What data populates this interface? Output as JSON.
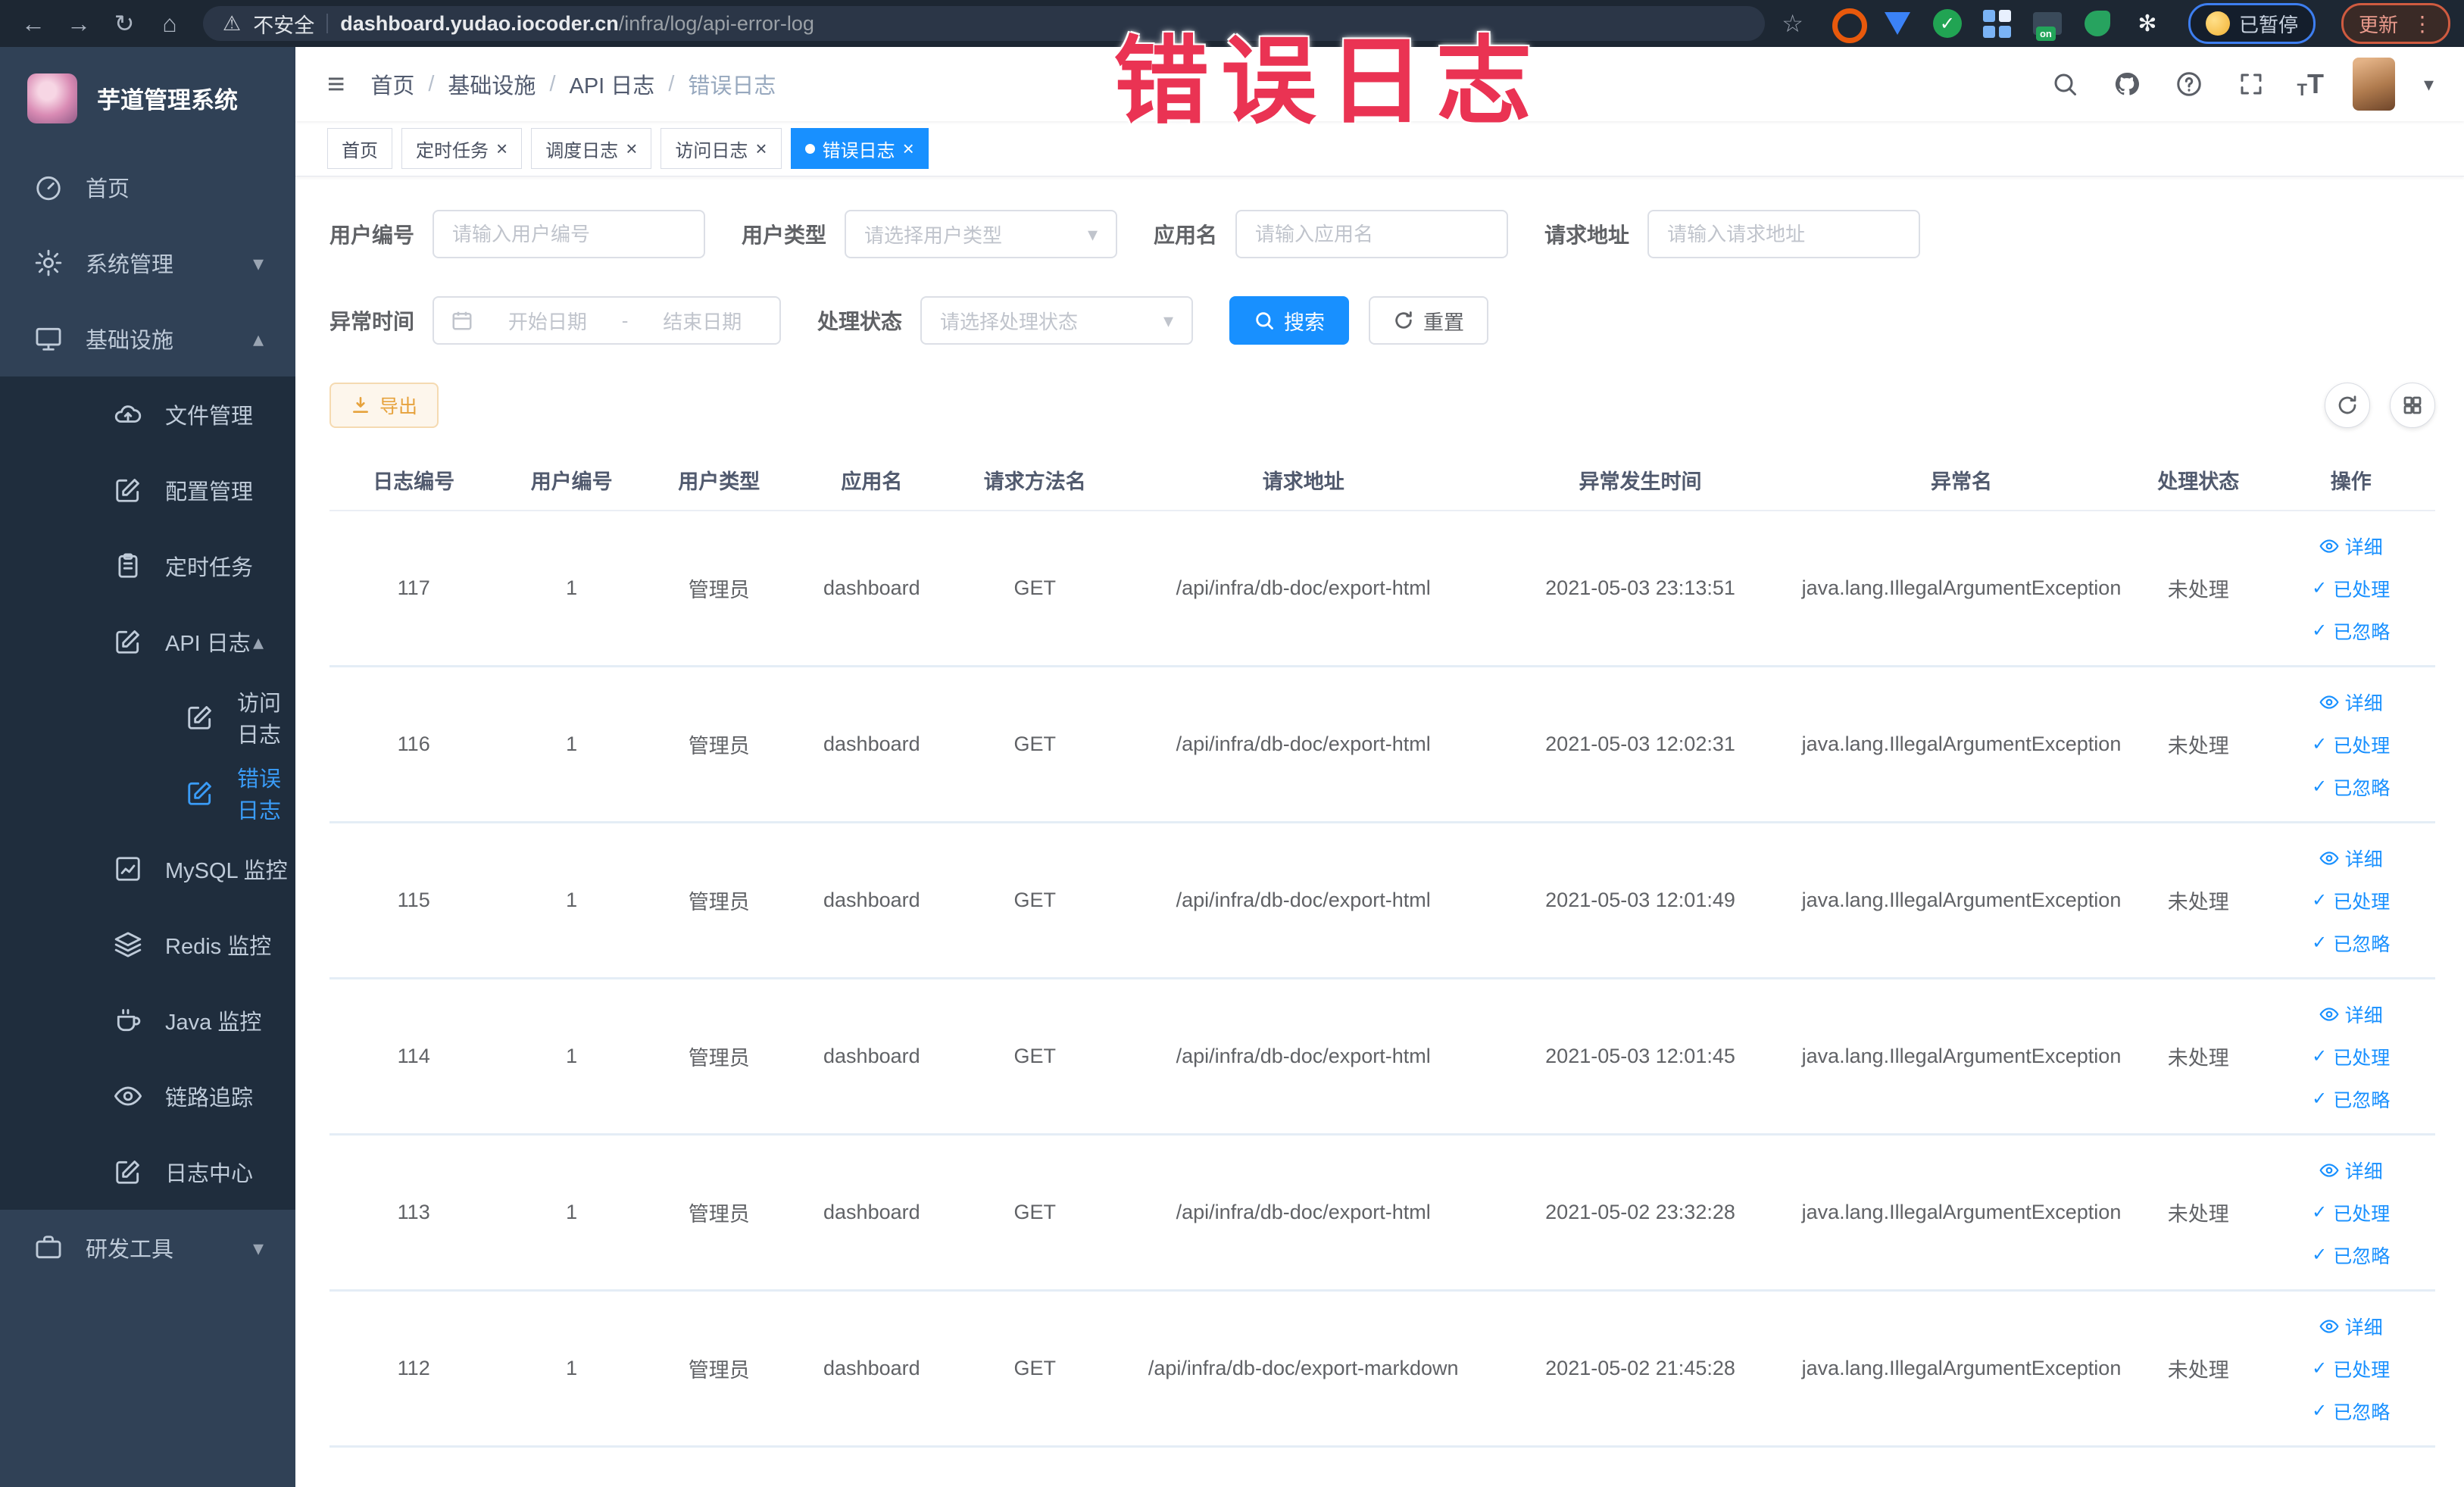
{
  "browser": {
    "security_label": "不安全",
    "url_domain": "dashboard.yudao.iocoder.cn",
    "url_path": "/infra/log/api-error-log",
    "paused_label": "已暂停",
    "update_label": "更新"
  },
  "watermark": {
    "text": "错误日志"
  },
  "sidebar": {
    "logo_title": "芋道管理系统",
    "items": [
      {
        "label": "首页",
        "icon": "dashboard-icon",
        "icon_ref": "#i-gauge",
        "level": 1,
        "dark": false,
        "active": false,
        "chevron": null
      },
      {
        "label": "系统管理",
        "icon": "gear-icon",
        "icon_ref": "#i-gear",
        "level": 1,
        "dark": false,
        "active": false,
        "chevron": "down"
      },
      {
        "label": "基础设施",
        "icon": "monitor-icon",
        "icon_ref": "#i-monitor",
        "level": 1,
        "dark": false,
        "active": false,
        "chevron": "up"
      },
      {
        "label": "文件管理",
        "icon": "cloud-upload-icon",
        "icon_ref": "#i-cloud",
        "level": 2,
        "dark": true,
        "active": false,
        "chevron": null
      },
      {
        "label": "配置管理",
        "icon": "edit-square-icon",
        "icon_ref": "#i-edit",
        "level": 2,
        "dark": true,
        "active": false,
        "chevron": null
      },
      {
        "label": "定时任务",
        "icon": "clipboard-icon",
        "icon_ref": "#i-clipboard",
        "level": 2,
        "dark": true,
        "active": false,
        "chevron": null
      },
      {
        "label": "API 日志",
        "icon": "edit-square-icon",
        "icon_ref": "#i-edit",
        "level": 2,
        "dark": true,
        "active": false,
        "chevron": "up"
      },
      {
        "label": "访问日志",
        "icon": "edit-square-icon",
        "icon_ref": "#i-edit",
        "level": 3,
        "dark": true,
        "active": false,
        "chevron": null
      },
      {
        "label": "错误日志",
        "icon": "edit-square-icon",
        "icon_ref": "#i-edit",
        "level": 3,
        "dark": true,
        "active": true,
        "chevron": null
      },
      {
        "label": "MySQL 监控",
        "icon": "chart-icon",
        "icon_ref": "#i-chart",
        "level": 2,
        "dark": true,
        "active": false,
        "chevron": null
      },
      {
        "label": "Redis 监控",
        "icon": "layers-icon",
        "icon_ref": "#i-layers",
        "level": 2,
        "dark": true,
        "active": false,
        "chevron": null
      },
      {
        "label": "Java 监控",
        "icon": "coffee-icon",
        "icon_ref": "#i-cup",
        "level": 2,
        "dark": true,
        "active": false,
        "chevron": null
      },
      {
        "label": "链路追踪",
        "icon": "eye-icon",
        "icon_ref": "#i-eye",
        "level": 2,
        "dark": true,
        "active": false,
        "chevron": null
      },
      {
        "label": "日志中心",
        "icon": "edit-square-icon",
        "icon_ref": "#i-edit",
        "level": 2,
        "dark": true,
        "active": false,
        "chevron": null
      },
      {
        "label": "研发工具",
        "icon": "briefcase-icon",
        "icon_ref": "#i-case",
        "level": 1,
        "dark": false,
        "active": false,
        "chevron": "down"
      }
    ]
  },
  "header": {
    "breadcrumb": [
      {
        "label": "首页",
        "current": false
      },
      {
        "label": "基础设施",
        "current": false
      },
      {
        "label": "API 日志",
        "current": false
      },
      {
        "label": "错误日志",
        "current": true
      }
    ]
  },
  "tags": [
    {
      "label": "首页",
      "active": false,
      "closable": false
    },
    {
      "label": "定时任务",
      "active": false,
      "closable": true
    },
    {
      "label": "调度日志",
      "active": false,
      "closable": true
    },
    {
      "label": "访问日志",
      "active": false,
      "closable": true
    },
    {
      "label": "错误日志",
      "active": true,
      "closable": true
    }
  ],
  "filters": {
    "user_id": {
      "label": "用户编号",
      "placeholder": "请输入用户编号"
    },
    "user_type": {
      "label": "用户类型",
      "placeholder": "请选择用户类型"
    },
    "app_name": {
      "label": "应用名",
      "placeholder": "请输入应用名"
    },
    "req_url": {
      "label": "请求地址",
      "placeholder": "请输入请求地址"
    },
    "error_time": {
      "label": "异常时间",
      "start_placeholder": "开始日期",
      "separator": "-",
      "end_placeholder": "结束日期"
    },
    "status": {
      "label": "处理状态",
      "placeholder": "请选择处理状态"
    },
    "search_label": "搜索",
    "reset_label": "重置"
  },
  "toolbar": {
    "export_label": "导出"
  },
  "table": {
    "columns": [
      "日志编号",
      "用户编号",
      "用户类型",
      "应用名",
      "请求方法名",
      "请求地址",
      "异常发生时间",
      "异常名",
      "处理状态",
      "操作"
    ],
    "row_actions": {
      "detail": "详细",
      "processed": "已处理",
      "ignored": "已忽略"
    },
    "rows": [
      {
        "log_id": "117",
        "user_id": "1",
        "user_type": "管理员",
        "app_name": "dashboard",
        "method": "GET",
        "url": "/api/infra/db-doc/export-html",
        "time": "2021-05-03 23:13:51",
        "exception": "java.lang.IllegalArgumentException",
        "status": "未处理"
      },
      {
        "log_id": "116",
        "user_id": "1",
        "user_type": "管理员",
        "app_name": "dashboard",
        "method": "GET",
        "url": "/api/infra/db-doc/export-html",
        "time": "2021-05-03 12:02:31",
        "exception": "java.lang.IllegalArgumentException",
        "status": "未处理"
      },
      {
        "log_id": "115",
        "user_id": "1",
        "user_type": "管理员",
        "app_name": "dashboard",
        "method": "GET",
        "url": "/api/infra/db-doc/export-html",
        "time": "2021-05-03 12:01:49",
        "exception": "java.lang.IllegalArgumentException",
        "status": "未处理"
      },
      {
        "log_id": "114",
        "user_id": "1",
        "user_type": "管理员",
        "app_name": "dashboard",
        "method": "GET",
        "url": "/api/infra/db-doc/export-html",
        "time": "2021-05-03 12:01:45",
        "exception": "java.lang.IllegalArgumentException",
        "status": "未处理"
      },
      {
        "log_id": "113",
        "user_id": "1",
        "user_type": "管理员",
        "app_name": "dashboard",
        "method": "GET",
        "url": "/api/infra/db-doc/export-html",
        "time": "2021-05-02 23:32:28",
        "exception": "java.lang.IllegalArgumentException",
        "status": "未处理"
      },
      {
        "log_id": "112",
        "user_id": "1",
        "user_type": "管理员",
        "app_name": "dashboard",
        "method": "GET",
        "url": "/api/infra/db-doc/export-markdown",
        "time": "2021-05-02 21:45:28",
        "exception": "java.lang.IllegalArgumentException",
        "status": "未处理"
      }
    ]
  },
  "colors": {
    "primary": "#1890ff",
    "warning": "#e6a23c",
    "watermark_red": "#ea3353",
    "sidebar_bg": "#304156",
    "submenu_bg": "#1f2d3d"
  }
}
